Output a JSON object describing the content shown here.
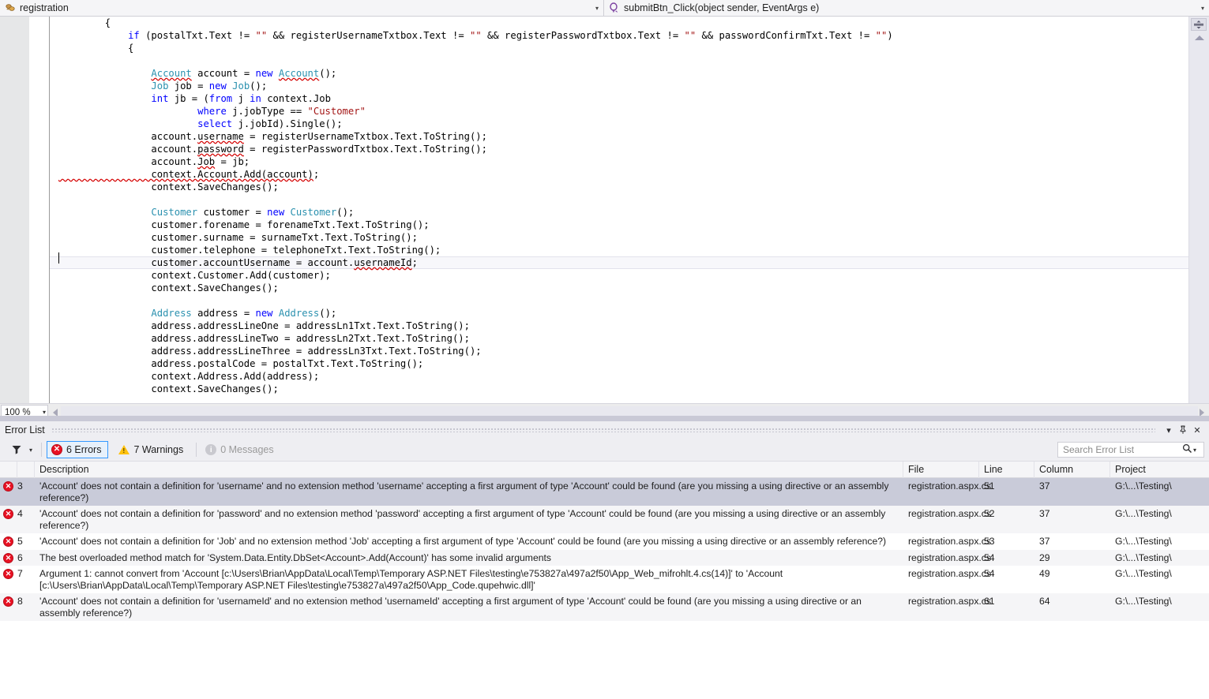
{
  "navbar": {
    "left": {
      "icon": "class-selector-icon",
      "text": "registration",
      "dropdown": "▾"
    },
    "right": {
      "icon": "method-selector-icon",
      "text": "submitBtn_Click(object sender, EventArgs e)",
      "dropdown": "▾"
    }
  },
  "editor": {
    "zoom_label": "100 %",
    "zoom_arrow": "▾",
    "lines": [
      [
        {
          "t": "plain",
          "v": "        {"
        }
      ],
      [
        {
          "t": "plain",
          "v": "            "
        },
        {
          "t": "keyword",
          "v": "if"
        },
        {
          "t": "plain",
          "v": " (postalTxt.Text != "
        },
        {
          "t": "string",
          "v": "\"\""
        },
        {
          "t": "plain",
          "v": " && registerUsernameTxtbox.Text != "
        },
        {
          "t": "string",
          "v": "\"\""
        },
        {
          "t": "plain",
          "v": " && registerPasswordTxtbox.Text != "
        },
        {
          "t": "string",
          "v": "\"\""
        },
        {
          "t": "plain",
          "v": " && passwordConfirmTxt.Text != "
        },
        {
          "t": "string",
          "v": "\"\""
        },
        {
          "t": "plain",
          "v": ")"
        }
      ],
      [
        {
          "t": "plain",
          "v": "            {"
        }
      ],
      [
        {
          "t": "plain",
          "v": ""
        }
      ],
      [
        {
          "t": "plain",
          "v": "                "
        },
        {
          "t": "type-err",
          "v": "Account"
        },
        {
          "t": "plain",
          "v": " account = "
        },
        {
          "t": "keyword",
          "v": "new"
        },
        {
          "t": "plain",
          "v": " "
        },
        {
          "t": "type-err",
          "v": "Account"
        },
        {
          "t": "plain",
          "v": "();"
        }
      ],
      [
        {
          "t": "plain",
          "v": "                "
        },
        {
          "t": "type",
          "v": "Job"
        },
        {
          "t": "plain",
          "v": " job = "
        },
        {
          "t": "keyword",
          "v": "new"
        },
        {
          "t": "plain",
          "v": " "
        },
        {
          "t": "type",
          "v": "Job"
        },
        {
          "t": "plain",
          "v": "();"
        }
      ],
      [
        {
          "t": "plain",
          "v": "                "
        },
        {
          "t": "keyword",
          "v": "int"
        },
        {
          "t": "plain",
          "v": " jb = ("
        },
        {
          "t": "keyword",
          "v": "from"
        },
        {
          "t": "plain",
          "v": " j "
        },
        {
          "t": "keyword",
          "v": "in"
        },
        {
          "t": "plain",
          "v": " context.Job"
        }
      ],
      [
        {
          "t": "plain",
          "v": "                        "
        },
        {
          "t": "keyword",
          "v": "where"
        },
        {
          "t": "plain",
          "v": " j.jobType == "
        },
        {
          "t": "string",
          "v": "\"Customer\""
        }
      ],
      [
        {
          "t": "plain",
          "v": "                        "
        },
        {
          "t": "keyword",
          "v": "select"
        },
        {
          "t": "plain",
          "v": " j.jobId).Single();"
        }
      ],
      [
        {
          "t": "plain",
          "v": "                account."
        },
        {
          "t": "err",
          "v": "username"
        },
        {
          "t": "plain",
          "v": " = registerUsernameTxtbox.Text.ToString();"
        }
      ],
      [
        {
          "t": "plain",
          "v": "                account."
        },
        {
          "t": "err",
          "v": "password"
        },
        {
          "t": "plain",
          "v": " = registerPasswordTxtbox.Text.ToString();"
        }
      ],
      [
        {
          "t": "plain",
          "v": "                account."
        },
        {
          "t": "err",
          "v": "Job"
        },
        {
          "t": "plain",
          "v": " = jb;"
        }
      ],
      [
        {
          "t": "err",
          "v": "                context.Account.Add(account)"
        },
        {
          "t": "plain",
          "v": ";"
        }
      ],
      [
        {
          "t": "plain",
          "v": "                context.SaveChanges();"
        }
      ],
      [
        {
          "t": "plain",
          "v": ""
        }
      ],
      [
        {
          "t": "plain",
          "v": "                "
        },
        {
          "t": "type",
          "v": "Customer"
        },
        {
          "t": "plain",
          "v": " customer = "
        },
        {
          "t": "keyword",
          "v": "new"
        },
        {
          "t": "plain",
          "v": " "
        },
        {
          "t": "type",
          "v": "Customer"
        },
        {
          "t": "plain",
          "v": "();"
        }
      ],
      [
        {
          "t": "plain",
          "v": "                customer.forename = forenameTxt.Text.ToString();"
        }
      ],
      [
        {
          "t": "plain",
          "v": "                customer.surname = surnameTxt.Text.ToString();"
        }
      ],
      [
        {
          "t": "plain",
          "v": "                customer.telephone = telephoneTxt.Text.ToString();"
        }
      ],
      [
        {
          "t": "plain",
          "v": "                customer.accountUsername = account."
        },
        {
          "t": "err",
          "v": "usernameId"
        },
        {
          "t": "plain",
          "v": ";"
        }
      ],
      [
        {
          "t": "plain",
          "v": "                context.Customer.Add(customer);"
        }
      ],
      [
        {
          "t": "plain",
          "v": "                context.SaveChanges();"
        }
      ],
      [
        {
          "t": "plain",
          "v": ""
        }
      ],
      [
        {
          "t": "plain",
          "v": "                "
        },
        {
          "t": "type",
          "v": "Address"
        },
        {
          "t": "plain",
          "v": " address = "
        },
        {
          "t": "keyword",
          "v": "new"
        },
        {
          "t": "plain",
          "v": " "
        },
        {
          "t": "type",
          "v": "Address"
        },
        {
          "t": "plain",
          "v": "();"
        }
      ],
      [
        {
          "t": "plain",
          "v": "                address.addressLineOne = addressLn1Txt.Text.ToString();"
        }
      ],
      [
        {
          "t": "plain",
          "v": "                address.addressLineTwo = addressLn2Txt.Text.ToString();"
        }
      ],
      [
        {
          "t": "plain",
          "v": "                address.addressLineThree = addressLn3Txt.Text.ToString();"
        }
      ],
      [
        {
          "t": "plain",
          "v": "                address.postalCode = postalTxt.Text.ToString();"
        }
      ],
      [
        {
          "t": "plain",
          "v": "                context.Address.Add(address);"
        }
      ],
      [
        {
          "t": "plain",
          "v": "                context.SaveChanges();"
        }
      ]
    ],
    "current_line_index": 19,
    "colors": {
      "keyword": "#0000ff",
      "type": "#2b91af",
      "string": "#a31515",
      "plain": "#000000",
      "error_squiggle": "#d40000",
      "warn_squiggle": "#8c8cd8"
    }
  },
  "error_list": {
    "title": "Error List",
    "titlebar_buttons": [
      "▾",
      "pin-icon",
      "✕"
    ],
    "toolbar": {
      "filter_icon": "filter-icon",
      "filter_arrow": "▾",
      "errors_label": "6 Errors",
      "warnings_label": "7 Warnings",
      "messages_label": "0 Messages",
      "errors_selected": true,
      "search_placeholder": "Search Error List"
    },
    "columns": [
      "Description",
      "File",
      "Line",
      "Column",
      "Project"
    ],
    "rows": [
      {
        "severity": "error",
        "num": "3",
        "description": "'Account' does not contain a definition for 'username' and no extension method 'username' accepting a first argument of type 'Account' could be found (are you missing a using directive or an assembly reference?)",
        "file": "registration.aspx.cs",
        "line": "51",
        "column": "37",
        "project": "G:\\...\\Testing\\",
        "selected": true
      },
      {
        "severity": "error",
        "num": "4",
        "description": "'Account' does not contain a definition for 'password' and no extension method 'password' accepting a first argument of type 'Account' could be found (are you missing a using directive or an assembly reference?)",
        "file": "registration.aspx.cs",
        "line": "52",
        "column": "37",
        "project": "G:\\...\\Testing\\",
        "selected": false
      },
      {
        "severity": "error",
        "num": "5",
        "description": "'Account' does not contain a definition for 'Job' and no extension method 'Job' accepting a first argument of type 'Account' could be found (are you missing a using directive or an assembly reference?)",
        "file": "registration.aspx.cs",
        "line": "53",
        "column": "37",
        "project": "G:\\...\\Testing\\",
        "selected": false
      },
      {
        "severity": "error",
        "num": "6",
        "description": "The best overloaded method match for 'System.Data.Entity.DbSet<Account>.Add(Account)' has some invalid arguments",
        "file": "registration.aspx.cs",
        "line": "54",
        "column": "29",
        "project": "G:\\...\\Testing\\",
        "selected": false
      },
      {
        "severity": "error",
        "num": "7",
        "description": "Argument 1: cannot convert from 'Account [c:\\Users\\Brian\\AppData\\Local\\Temp\\Temporary ASP.NET Files\\testing\\e753827a\\497a2f50\\App_Web_mifrohlt.4.cs(14)]' to 'Account [c:\\Users\\Brian\\AppData\\Local\\Temp\\Temporary ASP.NET Files\\testing\\e753827a\\497a2f50\\App_Code.qupehwic.dll]'",
        "file": "registration.aspx.cs",
        "line": "54",
        "column": "49",
        "project": "G:\\...\\Testing\\",
        "selected": false
      },
      {
        "severity": "error",
        "num": "8",
        "description": "'Account' does not contain a definition for 'usernameId' and no extension method 'usernameId' accepting a first argument of type 'Account' could be found (are you missing a using directive or an assembly reference?)",
        "file": "registration.aspx.cs",
        "line": "61",
        "column": "64",
        "project": "G:\\...\\Testing\\",
        "selected": false
      }
    ]
  }
}
